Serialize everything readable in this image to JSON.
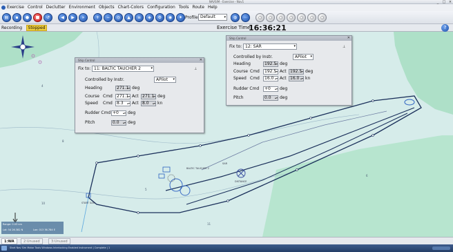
{
  "window": {
    "title": "NAVSIM - Exercise - Nav1",
    "controls": [
      "_",
      "□",
      "×"
    ]
  },
  "menu": {
    "items": [
      "Exercise",
      "Control",
      "Declutter",
      "Environment",
      "Objects",
      "Chart-Colors",
      "Configuration",
      "Tools",
      "Route",
      "Help"
    ]
  },
  "toolbar": {
    "profile_label": "Profile",
    "profile_value": "Default",
    "buttons": [
      "open-icon",
      "save-icon",
      "record-icon",
      "stop-icon",
      "reset-icon",
      "rewind-icon",
      "play-icon",
      "fast-forward-icon",
      "zoom-in-icon",
      "zoom-out-icon",
      "center-icon",
      "ship-icon",
      "layer-icon",
      "chart-icon",
      "settings-icon",
      "camera-icon",
      "compass-icon",
      "radar-icon",
      "trail-icon",
      "measure-icon",
      "info-icon",
      "grid-icon"
    ]
  },
  "status": {
    "recording_label": "Recording",
    "state": "Stopped",
    "time_label": "Exercise Time:",
    "time_value": "16:36:21"
  },
  "panel_left": {
    "title": "Ship Control",
    "fix_label": "Fix to:",
    "fix_value": "11: BALTIC TAUCHER 2",
    "controlled_label": "Controlled by Instr.",
    "controlled_value": "APilot",
    "heading_label": "Heading",
    "heading_value": "271.1",
    "course_label": "Course",
    "course_cmd": "271.1",
    "course_act": "271.1",
    "speed_label": "Speed",
    "speed_cmd": "8.3",
    "speed_act": "8.0",
    "rudder_label": "Rudder Cmd",
    "rudder_value": "+0",
    "pitch_label": "Pitch",
    "pitch_value": "0.0",
    "cmd_label": "Cmd",
    "act_label": "Act",
    "deg": "deg",
    "kn": "kn"
  },
  "panel_right": {
    "title": "Ship Control",
    "fix_label": "Fix to:",
    "fix_value": "12: SAR",
    "controlled_label": "Controlled by Instr.",
    "controlled_value": "APilot",
    "heading_label": "Heading",
    "heading_value": "192.5",
    "course_label": "Course",
    "course_cmd": "192.5",
    "course_act": "192.5",
    "speed_label": "Speed",
    "speed_cmd": "16.0",
    "speed_act": "16.0",
    "rudder_label": "Rudder Cmd",
    "rudder_value": "+0",
    "pitch_label": "Pitch",
    "pitch_value": "0.0",
    "cmd_label": "Cmd",
    "act_label": "Act",
    "deg": "deg",
    "kn": "kn"
  },
  "map": {
    "labels": {
      "sar": "SAR",
      "baltic": "BALTIC TAUCHER 2",
      "dist": "DISTANCE",
      "start": "START SAR"
    }
  },
  "infobox": {
    "line1": "Range: 0.03 nm",
    "line2": "Lat: 54 26.382 N",
    "line3": "Lon: 013 36.784 E"
  },
  "tabs": [
    "1:WA",
    "2:Unused",
    "3:Unused"
  ],
  "taskbar": {
    "text": "Start  Nav Sim  Motor  Tools  Windows  Interlocking  Enabled  Instrument  | Complete | 1"
  },
  "colors": {
    "accent": "#1c4fa8",
    "stopped": "#f0ce3a",
    "sea": "#d6ecea",
    "land": "#aee0c8",
    "track": "#1a2f5a"
  }
}
